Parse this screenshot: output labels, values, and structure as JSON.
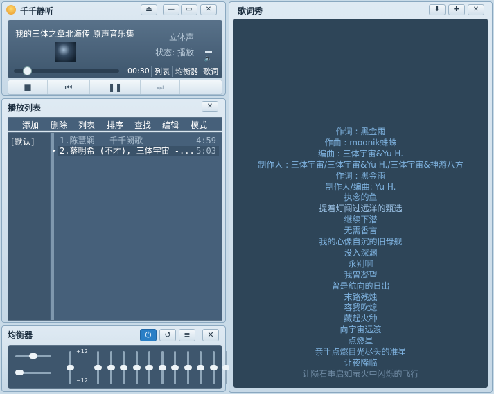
{
  "player": {
    "title": "千千静听",
    "buttons": [
      "⏏",
      "—",
      "▭",
      "✕"
    ],
    "song_title": "我的三体之章北海传 原声音乐集",
    "stereo": "立体声",
    "state": "状态: 播放",
    "time": "00:30",
    "progress": 0.12,
    "panel_buttons": [
      "列表",
      "均衡器",
      "歌词"
    ],
    "controls": [
      "■",
      "⏮",
      "❚❚",
      "⏭"
    ]
  },
  "playlist": {
    "title": "播放列表",
    "close": "✕",
    "menu": [
      "添加",
      "删除",
      "列表",
      "排序",
      "查找",
      "编辑",
      "模式"
    ],
    "group": "[默认]",
    "tracks": [
      {
        "title": "1.陈慧娴 - 千千阙歌",
        "duration": "4:59",
        "active": false
      },
      {
        "title": "2.蔡明希 (不才), 三体宇宙 -...",
        "duration": "5:03",
        "active": true
      }
    ],
    "play_marker": "▸"
  },
  "equalizer": {
    "title": "均衡器",
    "buttons": [
      "⏻",
      "↺",
      "≡",
      "✕"
    ],
    "scale_top": "+12",
    "scale_bottom": "−12",
    "preamp_level": 0.5,
    "balance_level": 0.5,
    "band_levels": [
      0.5,
      0.5,
      0.5,
      0.5,
      0.5,
      0.5,
      0.5,
      0.5,
      0.5,
      0.5,
      0.5
    ],
    "accent": "#2a7fc6"
  },
  "lyrics": {
    "title": "歌词秀",
    "buttons": [
      "⬇",
      "✚",
      "✕"
    ],
    "lines": [
      "作词 : 黑金雨",
      "作曲 : moonik蛛蛛",
      "编曲 : 三体宇宙&Yu H.",
      "制作人 : 三体宇宙/三体宇宙&Yu H./三体宇宙&神游八方",
      "作词 : 黑金雨",
      "制作人/编曲: Yu H.",
      "执念的鱼",
      "提着灯闯过远洋的甄选",
      "继续下潜",
      "无需香言",
      "我的心像自沉的旧母舰",
      "没入深渊",
      "永别啊",
      "我曾凝望",
      "曾是航向的日出",
      "末路残烛",
      "容我吹熄",
      "藏起火种",
      "向宇宙远渡",
      "点燃星",
      "亲手点燃目光尽头的准星",
      "让夜降临",
      "让陨石重启如萤火中闪烁的飞行"
    ],
    "highlight_color": "#7fb3e0",
    "dim_color": "#6f8aa3"
  }
}
